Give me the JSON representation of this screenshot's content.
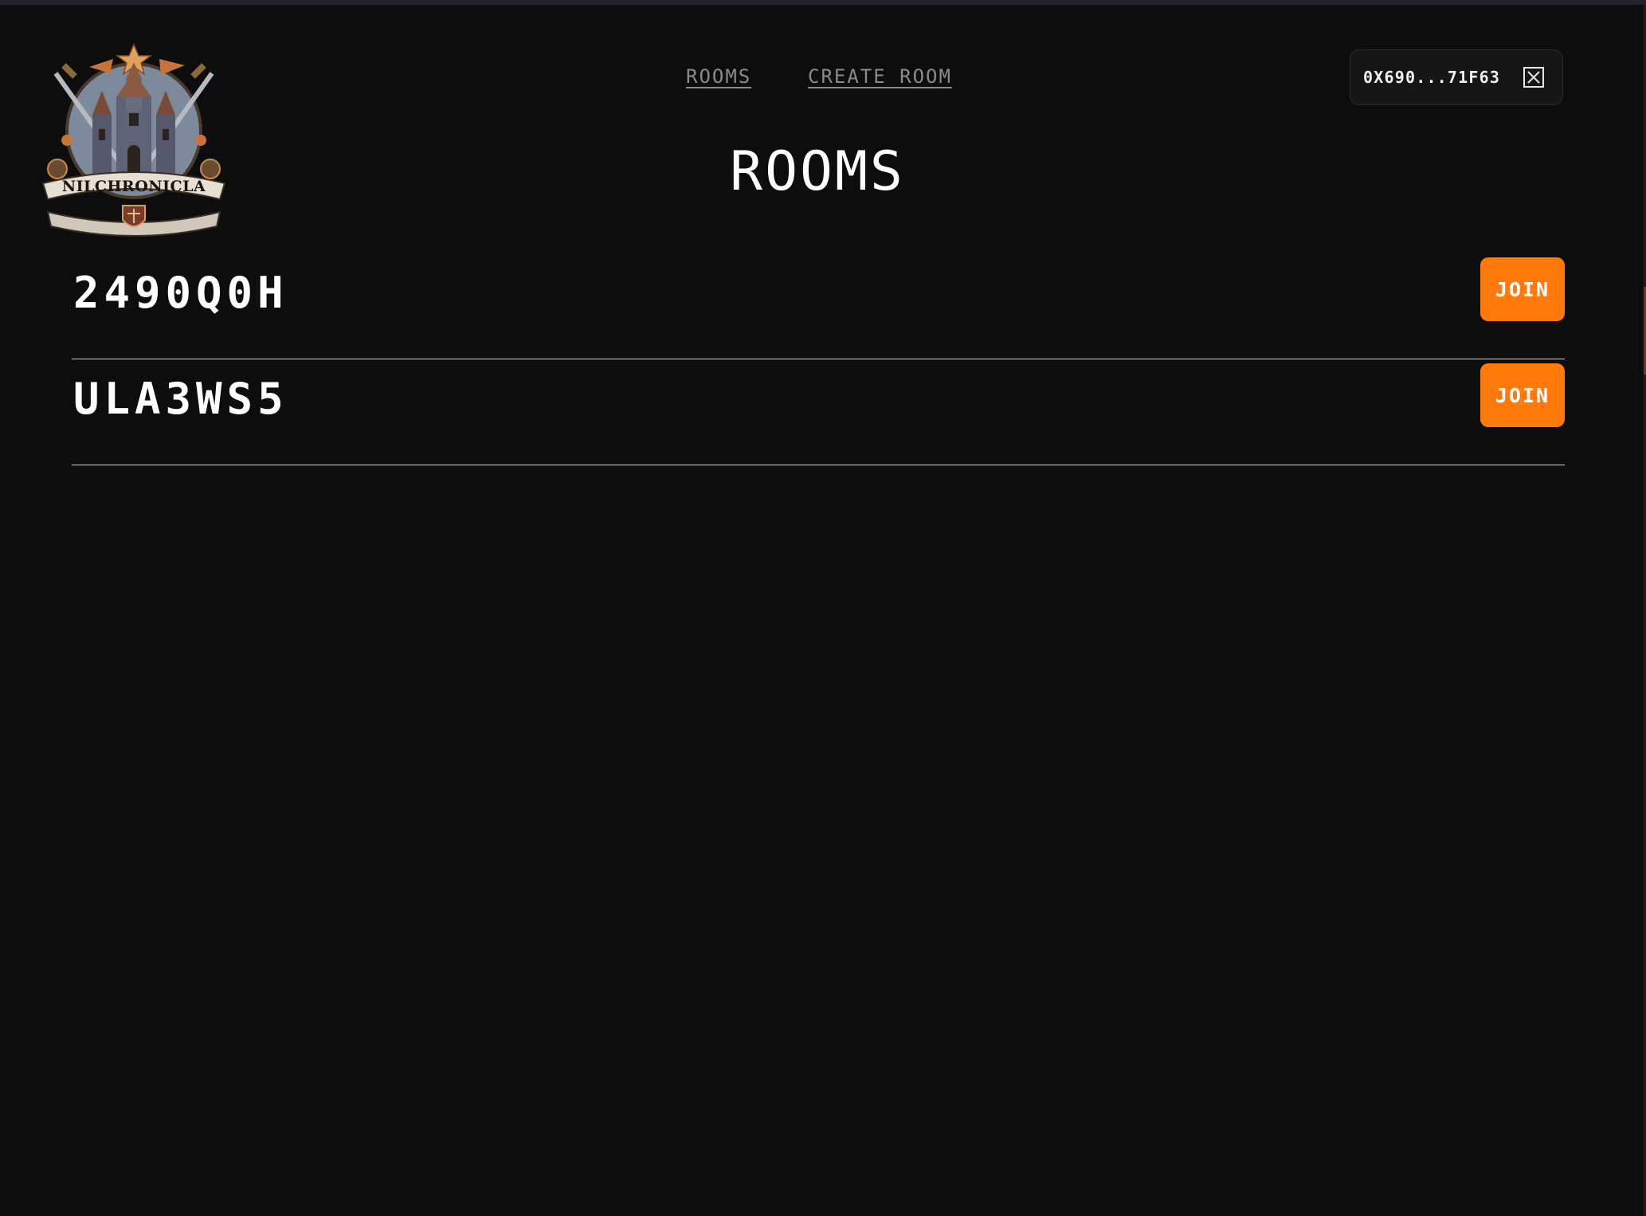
{
  "brand": {
    "logo_text": "NILCHRONICLA"
  },
  "nav": {
    "rooms_label": "ROOMS",
    "create_room_label": "CREATE ROOM"
  },
  "wallet": {
    "address": "0X690...71F63",
    "disconnect_icon": "close-box-icon"
  },
  "page": {
    "title": "ROOMS"
  },
  "rooms": [
    {
      "code": "2490Q0H",
      "join_label": "JOIN"
    },
    {
      "code": "ULA3WS5",
      "join_label": "JOIN"
    }
  ],
  "colors": {
    "background": "#0d0d0d",
    "accent": "#ff7a0a",
    "nav_link": "#8b8b8b",
    "divider": "#d0d0d0"
  }
}
